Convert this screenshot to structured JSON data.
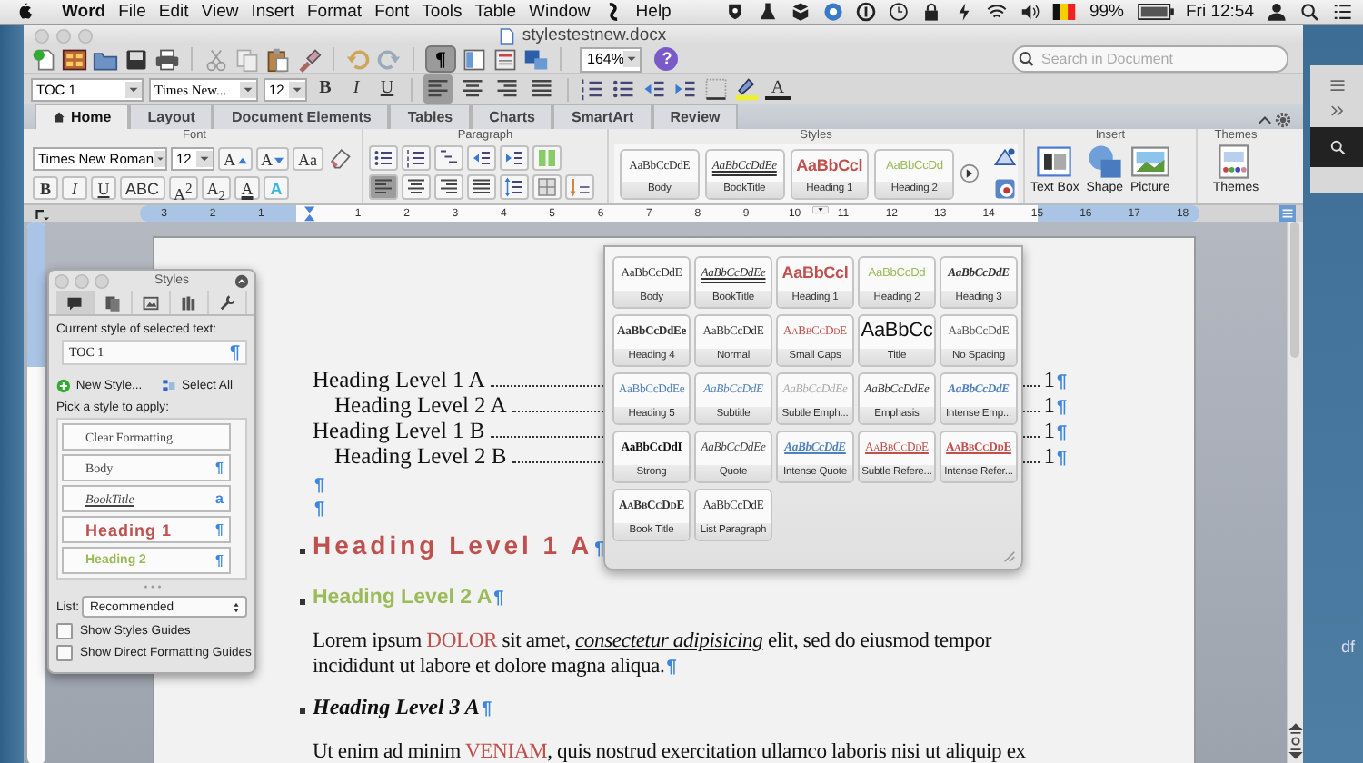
{
  "menubar": {
    "app": "Word",
    "items": [
      "File",
      "Edit",
      "View",
      "Insert",
      "Format",
      "Font",
      "Tools",
      "Table",
      "Window"
    ],
    "help": "Help",
    "battery": "99%",
    "clock": "Fri 12:54"
  },
  "window": {
    "title": "stylestestnew.docx"
  },
  "toolbar": {
    "marks": {
      "label": "¶",
      "on": true
    },
    "zoom": "164%",
    "help": "?",
    "search": {
      "placeholder": "Search in Document"
    }
  },
  "format_bar": {
    "style": "TOC 1",
    "font": "Times New...",
    "size": "12",
    "buttons": [
      {
        "label": "B",
        "kind": "bold"
      },
      {
        "label": "I",
        "kind": "italic"
      },
      {
        "label": "U",
        "kind": "underline"
      }
    ],
    "align": [
      {
        "selected": true
      },
      {
        "selected": false
      },
      {
        "selected": false
      },
      {
        "selected": false
      }
    ],
    "font_color": "A"
  },
  "ribbon": {
    "tabs": [
      {
        "label": "Home",
        "selected": true
      },
      {
        "label": "Layout",
        "selected": false
      },
      {
        "label": "Document Elements",
        "selected": false
      },
      {
        "label": "Tables",
        "selected": false
      },
      {
        "label": "Charts",
        "selected": false
      },
      {
        "label": "SmartArt",
        "selected": false
      },
      {
        "label": "Review",
        "selected": false
      }
    ],
    "font": {
      "title": "Font",
      "font": "Times New Roman",
      "size": "12",
      "top_buttons": [
        {
          "label": "A",
          "kind": "grow"
        },
        {
          "label": "A",
          "kind": "shrink"
        },
        {
          "label": "Aa",
          "kind": "case"
        }
      ],
      "buttons": [
        {
          "label": "B",
          "kind": "bold"
        },
        {
          "label": "I",
          "kind": "italic"
        },
        {
          "label": "U",
          "kind": "underline"
        },
        {
          "label": "ABC",
          "kind": "strike"
        },
        {
          "label": "A$^{2}$",
          "kind": "super"
        },
        {
          "label": "A$_{2}$",
          "kind": "sub"
        },
        {
          "label": "A",
          "kind": "color"
        },
        {
          "label": "A",
          "kind": "effects"
        }
      ]
    },
    "paragraph": {
      "title": "Paragraph",
      "align": [
        {
          "selected": true
        },
        {
          "selected": false
        },
        {
          "selected": false
        },
        {
          "selected": false
        }
      ]
    },
    "styles": {
      "title": "Styles",
      "tiles": [
        {
          "sample": "AaBbCcDdE",
          "label": "Body",
          "kind": "body"
        },
        {
          "sample": "AaBbCcDdEe",
          "label": "BookTitle",
          "kind": "booktitle"
        },
        {
          "sample": "AaBbCcl",
          "label": "Heading 1",
          "kind": "heading1"
        },
        {
          "sample": "AaBbCcDd",
          "label": "Heading 2",
          "kind": "heading2"
        }
      ]
    },
    "insert": {
      "title": "Insert",
      "items": [
        {
          "label": "Text Box",
          "kind": "textbox"
        },
        {
          "label": "Shape",
          "kind": "shape"
        },
        {
          "label": "Picture",
          "kind": "picture"
        }
      ]
    },
    "themes": {
      "title": "Themes",
      "label": "Themes"
    }
  },
  "ruler": {
    "labels": [
      "3",
      "2",
      "1",
      "1",
      "2",
      "3",
      "4",
      "5",
      "6",
      "7",
      "8",
      "9",
      "10",
      "11",
      "12",
      "13",
      "14",
      "15",
      "16",
      "17",
      "18"
    ]
  },
  "document": {
    "paragraphs": [
      {
        "kind": "toc1",
        "text": "Heading Level 1 A",
        "page": "1",
        "mark": "¶"
      },
      {
        "kind": "toc2",
        "text": "Heading Level 2 A",
        "page": "1",
        "mark": "¶"
      },
      {
        "kind": "toc1",
        "text": "Heading Level 1 B",
        "page": "1",
        "mark": "¶"
      },
      {
        "kind": "toc2",
        "text": "Heading Level 2 B",
        "page": "1",
        "mark": "¶"
      },
      {
        "kind": "empty",
        "mark": "¶"
      },
      {
        "kind": "empty",
        "mark": "¶"
      },
      {
        "kind": "heading1",
        "text": "Heading Level 1 A",
        "mark": "¶"
      },
      {
        "kind": "heading2",
        "text": "Heading Level 2 A",
        "mark": "¶"
      },
      {
        "kind": "body",
        "lines": [
          [
            {
              "text": "Lorem ipsum ",
              "kind": "plain"
            },
            {
              "text": "DOLOR",
              "kind": "accent"
            },
            {
              "text": " sit amet, ",
              "kind": "plain"
            },
            {
              "text": "consectetur adipisicing",
              "kind": "emphasis"
            },
            {
              "text": " elit, sed do eiusmod tempor",
              "kind": "plain"
            }
          ],
          [
            {
              "text": "incididunt ut labore et dolore magna aliqua.",
              "kind": "plain"
            }
          ]
        ],
        "mark": "¶"
      },
      {
        "kind": "heading3",
        "text": "Heading Level 3 A",
        "mark": "¶"
      },
      {
        "kind": "body",
        "lines": [
          [
            {
              "text": "Ut enim ad minim ",
              "kind": "plain"
            },
            {
              "text": "VENIAM",
              "kind": "accent"
            },
            {
              "text": ", quis nostrud exercitation ullamco laboris nisi ut aliquip ex",
              "kind": "plain"
            }
          ]
        ]
      }
    ]
  },
  "styles_palette": {
    "title": "Styles",
    "tabs": [
      {
        "selected": true
      },
      {
        "selected": false
      },
      {
        "selected": false
      },
      {
        "selected": false
      },
      {
        "selected": false
      }
    ],
    "current_label": "Current style of selected text:",
    "current": "TOC 1",
    "current_mark": "¶",
    "new_style": "New Style...",
    "select_all": "Select All",
    "pick_label": "Pick a style to apply:",
    "styles": [
      {
        "label": "Clear Formatting",
        "kind": "clear"
      },
      {
        "label": "Body",
        "kind": "body",
        "mark": "¶"
      },
      {
        "label": "BookTitle",
        "kind": "booktitle",
        "mark": "a"
      },
      {
        "label": "Heading 1",
        "kind": "heading1",
        "mark": "¶"
      },
      {
        "label": "Heading 2",
        "kind": "heading2",
        "mark": "¶"
      }
    ],
    "list_label": "List:",
    "list": "Recommended",
    "options": [
      {
        "label": "Show Styles Guides",
        "checked": false
      },
      {
        "label": "Show Direct Formatting Guides",
        "checked": false
      }
    ]
  },
  "style_gallery": {
    "tiles": [
      {
        "sample": "AaBbCcDdE",
        "label": "Body",
        "kind": "body"
      },
      {
        "sample": "AaBbCcDdEe",
        "label": "BookTitle",
        "kind": "booktitle"
      },
      {
        "sample": "AaBbCcl",
        "label": "Heading 1",
        "kind": "heading1"
      },
      {
        "sample": "AaBbCcDd",
        "label": "Heading 2",
        "kind": "heading2"
      },
      {
        "sample": "AaBbCcDdE",
        "label": "Heading 3",
        "kind": "heading3"
      },
      {
        "sample": "AaBbCcDdEe",
        "label": "Heading 4",
        "kind": "heading4"
      },
      {
        "sample": "AaBbCcDdE",
        "label": "Normal",
        "kind": "normal"
      },
      {
        "sample": "AaBbCcDdE",
        "label": "Small Caps",
        "kind": "smallcaps"
      },
      {
        "sample": "AaBbCc",
        "label": "Title",
        "kind": "title"
      },
      {
        "sample": "AaBbCcDdE",
        "label": "No Spacing",
        "kind": "nospacing"
      },
      {
        "sample": "AaBbCcDdEe",
        "label": "Heading 5",
        "kind": "heading5"
      },
      {
        "sample": "AaBbCcDdE",
        "label": "Subtitle",
        "kind": "subtitle"
      },
      {
        "sample": "AaBbCcDdEe",
        "label": "Subtle Emph...",
        "kind": "subtle"
      },
      {
        "sample": "AaBbCcDdEe",
        "label": "Emphasis",
        "kind": "emphasis"
      },
      {
        "sample": "AaBbCcDdE",
        "label": "Intense Emp...",
        "kind": "intense"
      },
      {
        "sample": "AaBbCcDdI",
        "label": "Strong",
        "kind": "strong"
      },
      {
        "sample": "AaBbCcDdEe",
        "label": "Quote",
        "kind": "quote"
      },
      {
        "sample": "AaBbCcDdE",
        "label": "Intense Quote",
        "kind": "intensequote"
      },
      {
        "sample": "AaBbCcDdE",
        "label": "Subtle Refere...",
        "kind": "subtleref"
      },
      {
        "sample": "AaBbCcDdE",
        "label": "Intense Refer...",
        "kind": "intenseref"
      },
      {
        "sample": "AaBbCcDdE",
        "label": "Book Title",
        "kind": "booktitle2"
      },
      {
        "sample": "AaBbCcDdE",
        "label": "List Paragraph",
        "kind": "listpara"
      }
    ]
  },
  "desktop": {
    "file_label": "df"
  }
}
